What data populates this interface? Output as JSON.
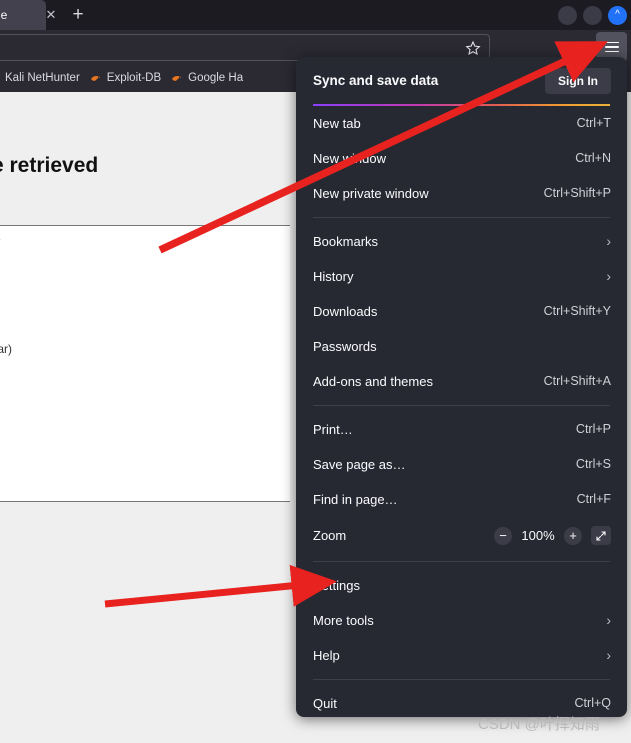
{
  "browser": {
    "tab": {
      "partial_title": "ge",
      "close_icon": "close-icon",
      "newtab_icon": "plus-icon"
    },
    "window_controls": [
      {
        "name": "window-button-1",
        "glyph": ""
      },
      {
        "name": "window-button-2",
        "glyph": ""
      },
      {
        "name": "window-button-collapse",
        "glyph": "⌃"
      }
    ],
    "urlbar": {
      "value": "",
      "placeholder": "",
      "bookmark_icon": "star-icon"
    },
    "toolbar": {
      "pocket_icon": "pocket-icon",
      "menu_icon": "hamburger-menu-icon"
    },
    "bookmarks": [
      {
        "label": "Kali NetHunter",
        "icon": "kali-dragon-icon"
      },
      {
        "label": "Exploit-DB",
        "icon": "kali-dragon-icon"
      },
      {
        "label": "Google Ha",
        "icon": "kali-dragon-icon"
      }
    ]
  },
  "page": {
    "heading": "e retrieved",
    "link_text": "/",
    "body_text": "ilar)"
  },
  "menu": {
    "sync": {
      "title": "Sync and save data",
      "signin_label": "Sign In"
    },
    "groups": [
      {
        "items": [
          {
            "label": "New tab",
            "accel": "Ctrl+T",
            "submenu": false,
            "name": "menu-item-new-tab"
          },
          {
            "label": "New window",
            "accel": "Ctrl+N",
            "submenu": false,
            "name": "menu-item-new-window"
          },
          {
            "label": "New private window",
            "accel": "Ctrl+Shift+P",
            "submenu": false,
            "name": "menu-item-new-private-window"
          }
        ]
      },
      {
        "items": [
          {
            "label": "Bookmarks",
            "accel": "",
            "submenu": true,
            "name": "menu-item-bookmarks"
          },
          {
            "label": "History",
            "accel": "",
            "submenu": true,
            "name": "menu-item-history"
          },
          {
            "label": "Downloads",
            "accel": "Ctrl+Shift+Y",
            "submenu": false,
            "name": "menu-item-downloads"
          },
          {
            "label": "Passwords",
            "accel": "",
            "submenu": false,
            "name": "menu-item-passwords"
          },
          {
            "label": "Add-ons and themes",
            "accel": "Ctrl+Shift+A",
            "submenu": false,
            "name": "menu-item-addons-and-themes"
          }
        ]
      },
      {
        "items": [
          {
            "label": "Print…",
            "accel": "Ctrl+P",
            "submenu": false,
            "name": "menu-item-print"
          },
          {
            "label": "Save page as…",
            "accel": "Ctrl+S",
            "submenu": false,
            "name": "menu-item-save-page-as"
          },
          {
            "label": "Find in page…",
            "accel": "Ctrl+F",
            "submenu": false,
            "name": "menu-item-find-in-page"
          }
        ]
      },
      {
        "items": [
          {
            "label": "Settings",
            "accel": "",
            "submenu": false,
            "name": "menu-item-settings"
          },
          {
            "label": "More tools",
            "accel": "",
            "submenu": true,
            "name": "menu-item-more-tools"
          },
          {
            "label": "Help",
            "accel": "",
            "submenu": true,
            "name": "menu-item-help"
          }
        ]
      },
      {
        "items": [
          {
            "label": "Quit",
            "accel": "Ctrl+Q",
            "submenu": false,
            "name": "menu-item-quit"
          }
        ]
      }
    ],
    "zoom": {
      "label": "Zoom",
      "level": "100%",
      "minus_icon": "minus-icon",
      "plus_icon": "plus-icon",
      "fullscreen_icon": "expand-icon"
    }
  },
  "annotations": {
    "arrow_color": "#e8221f",
    "arrow_to_menu_button": "arrow-pointing-to-hamburger-menu",
    "arrow_to_settings": "arrow-pointing-to-settings"
  },
  "watermark": {
    "text": "CSDN @叶挥知雨"
  }
}
